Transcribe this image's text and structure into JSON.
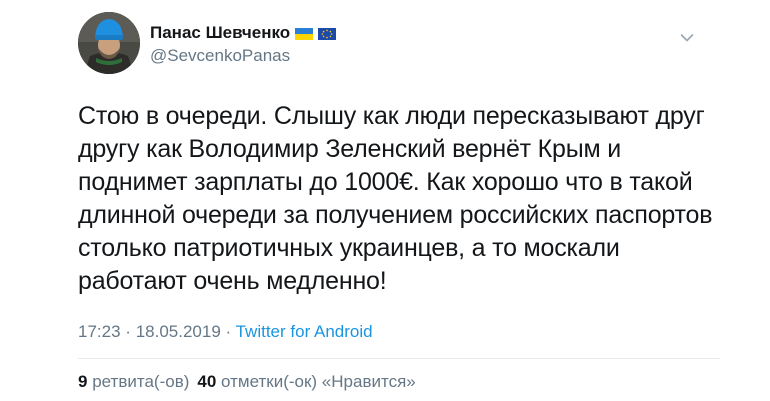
{
  "author": {
    "display_name": "Панас Шевченко",
    "handle": "@SevcenkoPanas",
    "flags": [
      "ukraine-flag",
      "eu-flag"
    ]
  },
  "tweet": {
    "text": "Стою в очереди. Слышу как люди пересказывают друг другу как Володимир Зеленский вернёт Крым и поднимет зарплаты до 1000€. Как хорошо что в такой длинной очереди за получением российских паспортов столько патриотичных украинцев, а то москали работают очень медленно!",
    "time": "17:23",
    "date": "18.05.2019",
    "separator": "·",
    "client": "Twitter for Android"
  },
  "stats": {
    "retweets_count": "9",
    "retweets_label": "ретвита(-ов)",
    "likes_count": "40",
    "likes_label": "отметки(-ок) «Нравится»"
  },
  "colors": {
    "text": "#14171a",
    "secondary": "#657786",
    "link": "#1b95e0",
    "divider": "#e6ecf0"
  },
  "icons": {
    "menu": "chevron-down-icon"
  }
}
